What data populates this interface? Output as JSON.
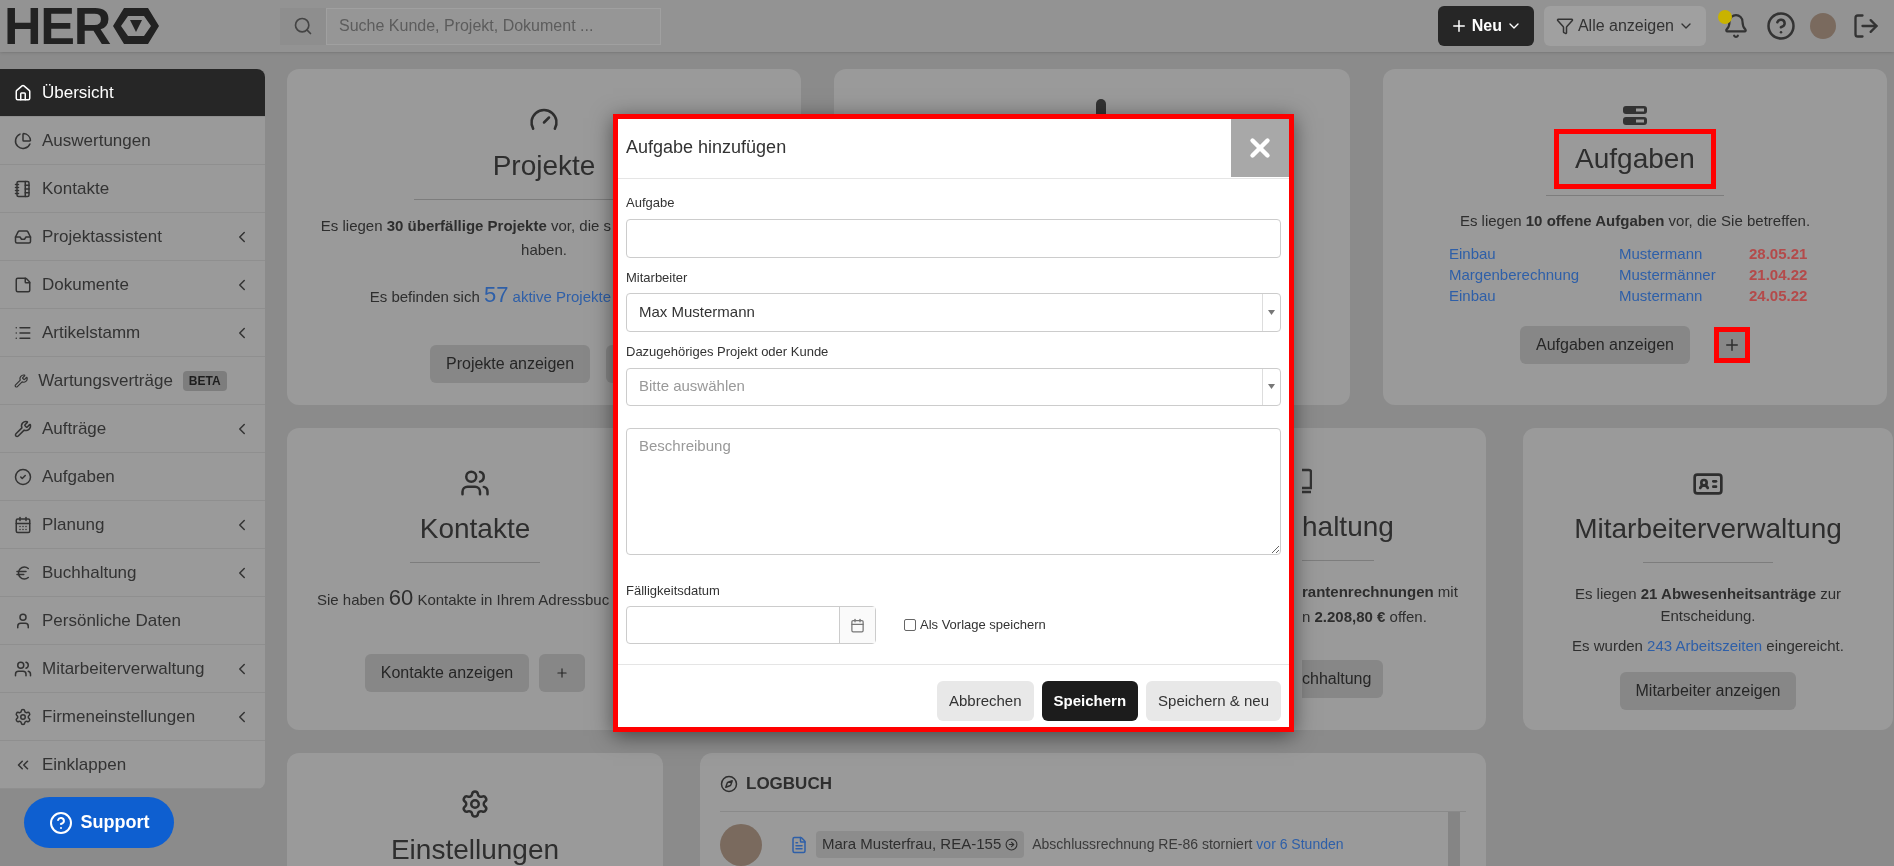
{
  "header": {
    "logo": "HER",
    "search": {
      "placeholder": "Suche Kunde, Projekt, Dokument ..."
    },
    "new_button": "Neu",
    "filter_button": "Alle anzeigen",
    "notification_dot": true
  },
  "sidebar": {
    "items": [
      {
        "label": "Übersicht",
        "selected": true,
        "submenu": false
      },
      {
        "label": "Auswertungen",
        "selected": false,
        "submenu": false
      },
      {
        "label": "Kontakte",
        "selected": false,
        "submenu": false
      },
      {
        "label": "Projektassistent",
        "selected": false,
        "submenu": true
      },
      {
        "label": "Dokumente",
        "selected": false,
        "submenu": true
      },
      {
        "label": "Artikelstamm",
        "selected": false,
        "submenu": true
      },
      {
        "label": "Wartungsverträge",
        "selected": false,
        "submenu": false,
        "badge": "BETA"
      },
      {
        "label": "Aufträge",
        "selected": false,
        "submenu": true
      },
      {
        "label": "Aufgaben",
        "selected": false,
        "submenu": false
      },
      {
        "label": "Planung",
        "selected": false,
        "submenu": true
      },
      {
        "label": "Buchhaltung",
        "selected": false,
        "submenu": true
      },
      {
        "label": "Persönliche Daten",
        "selected": false,
        "submenu": false
      },
      {
        "label": "Mitarbeiterverwaltung",
        "selected": false,
        "submenu": true
      },
      {
        "label": "Firmeneinstellungen",
        "selected": false,
        "submenu": true
      },
      {
        "label": "Einklappen",
        "selected": false,
        "submenu": false
      }
    ],
    "support_button": "Support"
  },
  "cards": {
    "projekte": {
      "title": "Projekte",
      "text": "Es liegen **30 überfällige Projekte** vor, die s",
      "text_2": "haben.",
      "active_prefix": "Es befinden sich",
      "active_count": "57",
      "active_link": "aktive Projekte",
      "button": "Projekte anzeigen"
    },
    "aufgaben": {
      "title": "Aufgaben",
      "title_highlighted": true,
      "text": "Es liegen **10 offene Aufgaben** vor, die Sie betreffen.",
      "tasks": [
        {
          "name": "Einbau",
          "person": "Mustermann",
          "date": "28.05.21"
        },
        {
          "name": "Margenberechnung",
          "person": "Mustermänner",
          "date": "21.04.22"
        },
        {
          "name": "Einbau",
          "person": "Mustermann",
          "date": "24.05.22"
        }
      ],
      "button": "Aufgaben anzeigen",
      "add_highlighted": true
    },
    "kontakte": {
      "title": "Kontakte",
      "prefix": "Sie haben",
      "count": "60",
      "suffix": "Kontakte in Ihrem Adressbuc",
      "button": "Kontakte anzeigen"
    },
    "buchhaltung": {
      "title": "haltung",
      "text": "**rantenrechnungen** mit",
      "text_2": "n **2.208,80 €** offen.",
      "button": "chhaltung"
    },
    "mitarbeiter": {
      "title": "Mitarbeiterverwaltung",
      "text": "Es liegen **21 Abwesenheitsanträge** zur Entscheidung.",
      "hours_prefix": "Es wurden",
      "hours_link": "243 Arbeitszeiten",
      "hours_suffix": "eingereicht.",
      "button": "Mitarbeiter anzeigen"
    },
    "einstellungen": {
      "title": "Einstellungen"
    },
    "logbuch": {
      "title": "LOGBUCH",
      "entries": [
        {
          "chip": "Mara Musterfrau, REA-155",
          "text": "Abschlussrechnung RE-86 storniert",
          "time": "vor 6 Stunden"
        }
      ]
    }
  },
  "modal": {
    "title": "Aufgabe hinzufügen",
    "highlighted": true,
    "task_label": "Aufgabe",
    "employee_label": "Mitarbeiter",
    "employee_value": "Max Mustermann",
    "project_label": "Dazugehöriges Projekt oder Kunde",
    "project_placeholder": "Bitte auswählen",
    "description_placeholder": "Beschreibung",
    "due_label": "Fälligkeitsdatum",
    "template": {
      "label": "Als Vorlage speichern",
      "checked": false
    },
    "buttons": {
      "cancel": "Abbrechen",
      "save": "Speichern",
      "save_new": "Speichern & neu"
    }
  }
}
